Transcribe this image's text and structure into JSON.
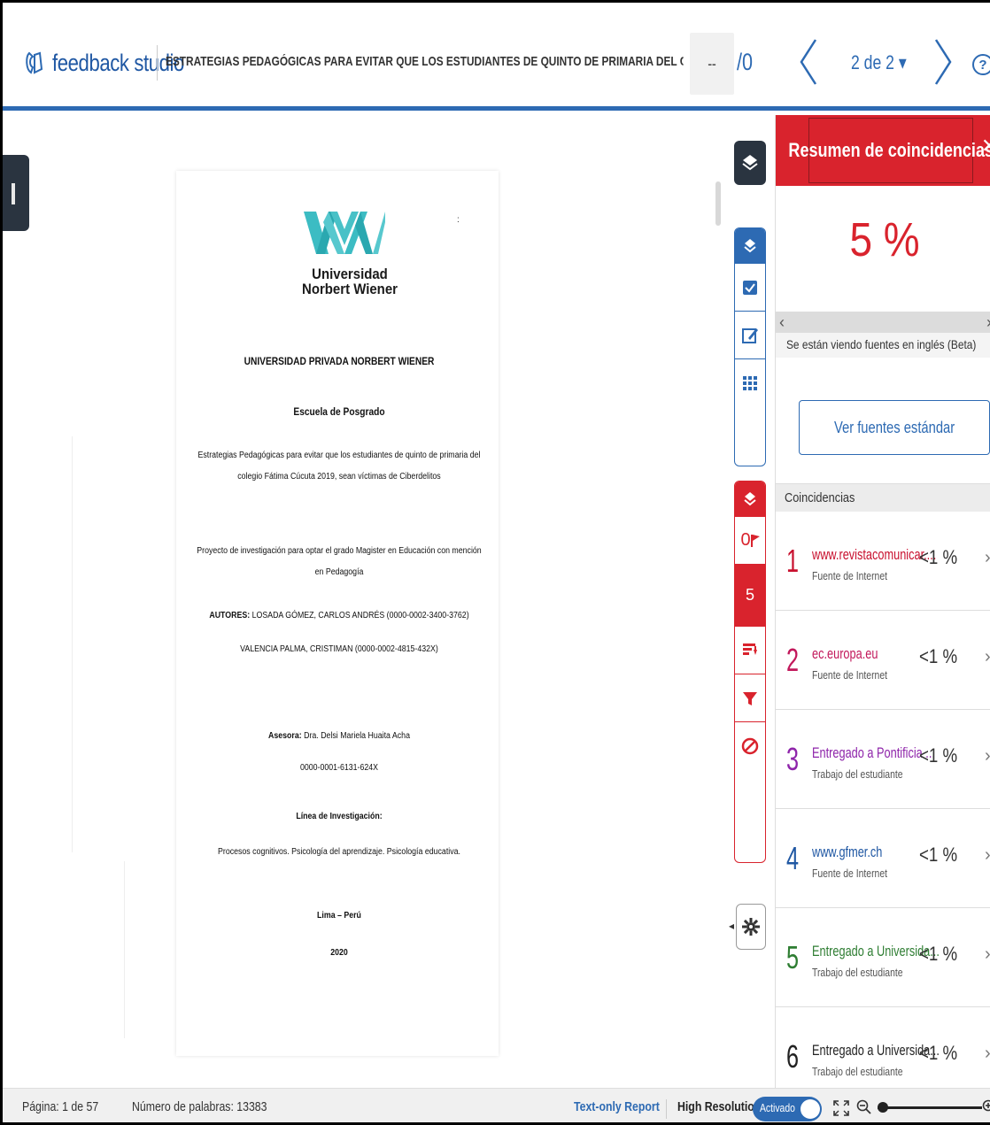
{
  "header": {
    "logo_text": "feedback studio",
    "doc_title": "ESTRATEGIAS PEDAGÓGICAS PARA EVITAR QUE LOS ESTUDIANTES DE QUINTO DE PRIMARIA DEL COLEGIO FÁTIMA C...",
    "grade_value": "--",
    "grade_total": "/0",
    "page_select": "2 de 2 ▾",
    "help": "?"
  },
  "document": {
    "university_name_line1": "Universidad",
    "university_name_line2": "Norbert Wiener",
    "dot": ":",
    "institution": "UNIVERSIDAD PRIVADA NORBERT WIENER",
    "school": "Escuela de Posgrado",
    "title_line1": "Estrategias Pedagógicas para evitar que los estudiantes de quinto de primaria del",
    "title_line2": "colegio Fátima Cúcuta 2019, sean víctimas de Ciberdelitos",
    "project_line1": "Proyecto de investigación para optar el grado Magister en Educación con mención",
    "project_line2": "en Pedagogía",
    "authors_label": "AUTORES:",
    "authors_line1": " LOSADA GÓMEZ, CARLOS ANDRÉS (0000-0002-3400-3762)",
    "authors_line2": "VALENCIA PALMA, CRISTIMAN (0000-0002-4815-432X)",
    "advisor_label": "Asesora:",
    "advisor_name": " Dra. Delsi Mariela Huaita Acha",
    "advisor_id": "0000-0001-6131-624X",
    "research_line_label": "Línea de Investigación:",
    "research_line": "Procesos cognitivos.  Psicología      del     aprendizaje. Psicología educativa.",
    "place": "Lima – Perú",
    "year": "2020"
  },
  "tools": {
    "flag_count": "0",
    "match_count": "5"
  },
  "panel": {
    "title": "Resumen de coincidencias",
    "close": "✕",
    "percent": "5 %",
    "lang_note": "Se están viendo fuentes en inglés (Beta)",
    "std_button": "Ver fuentes estándar",
    "matches_header": "Coincidencias",
    "matches": [
      {
        "num": "1",
        "source": "www.revistacomunicar....",
        "type": "Fuente de Internet",
        "pct": "<1 %",
        "color": "#c8102e"
      },
      {
        "num": "2",
        "source": "ec.europa.eu",
        "type": "Fuente de Internet",
        "pct": "<1 %",
        "color": "#c2185b"
      },
      {
        "num": "3",
        "source": "Entregado a Pontificia ...",
        "type": "Trabajo del estudiante",
        "pct": "<1 %",
        "color": "#8e24aa"
      },
      {
        "num": "4",
        "source": "www.gfmer.ch",
        "type": "Fuente de Internet",
        "pct": "<1 %",
        "color": "#1f57a3"
      },
      {
        "num": "5",
        "source": "Entregado a Universida...",
        "type": "Trabajo del estudiante",
        "pct": "<1 %",
        "color": "#2e7d32"
      },
      {
        "num": "6",
        "source": "Entregado a Universida...",
        "type": "Trabajo del estudiante",
        "pct": "<1 %",
        "color": "#222222"
      }
    ]
  },
  "footer": {
    "page_info": "Página: 1 de 57",
    "word_count": "Número de palabras: 13383",
    "text_only": "Text-only Report",
    "high_res": "High Resolution",
    "toggle_label": "Activado"
  },
  "colors": {
    "accent_blue": "#2d6ab3",
    "accent_red": "#d9232d",
    "dark": "#2a3440",
    "teal_logo": "#3cbcc3"
  }
}
